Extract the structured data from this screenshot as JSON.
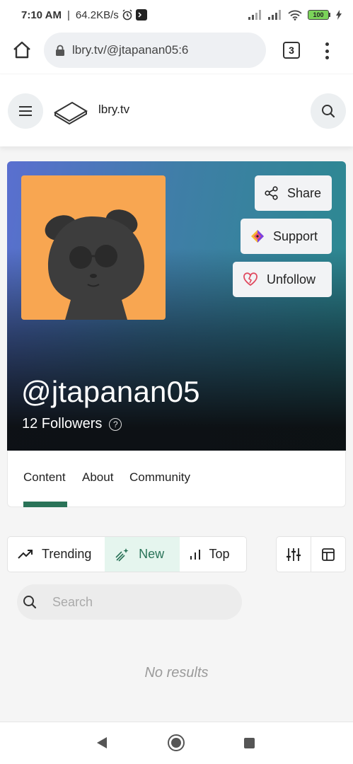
{
  "status_bar": {
    "time": "7:10 AM",
    "speed": "64.2KB/s",
    "battery": "100"
  },
  "browser": {
    "url": "lbry.tv/@jtapanan05:6",
    "tab_count": "3"
  },
  "site": {
    "brand": "lbry.tv"
  },
  "channel": {
    "name": "@jtapanan05",
    "followers": "12 Followers",
    "help_symbol": "?",
    "actions": {
      "share": "Share",
      "support": "Support",
      "unfollow": "Unfollow"
    }
  },
  "tabs": {
    "content": "Content",
    "about": "About",
    "community": "Community"
  },
  "filters": {
    "trending": "Trending",
    "new": "New",
    "top": "Top",
    "active": "new"
  },
  "search": {
    "placeholder": "Search"
  },
  "results": {
    "empty_message": "No results"
  },
  "colors": {
    "accent_green": "#2a7358",
    "active_filter_bg": "#e5f5ee",
    "avatar_bg": "#f8a651"
  }
}
